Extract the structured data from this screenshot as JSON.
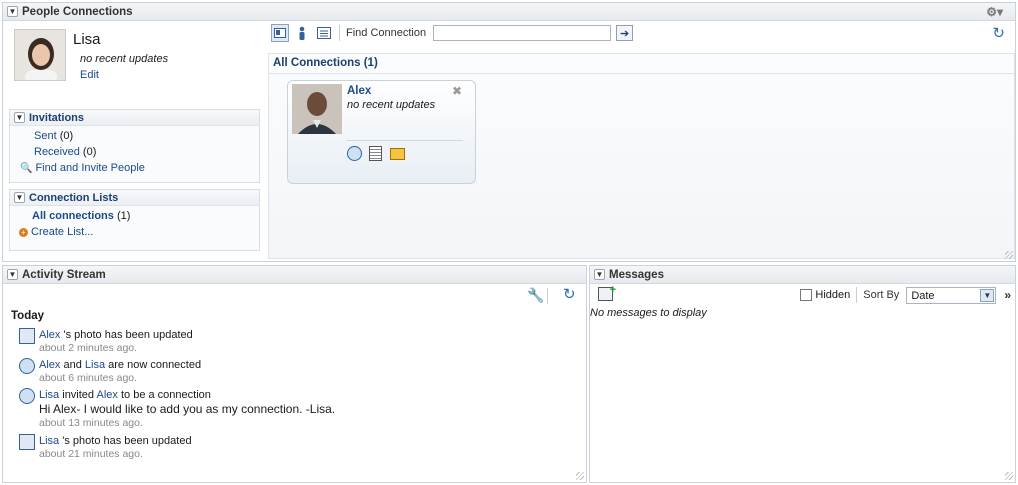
{
  "people_connections": {
    "title": "People Connections",
    "profile": {
      "name": "Lisa",
      "status": "no recent updates",
      "edit": "Edit"
    },
    "invitations": {
      "title": "Invitations",
      "sent_label": "Sent",
      "sent_count": "(0)",
      "received_label": "Received",
      "received_count": "(0)",
      "find_invite": "Find and Invite People"
    },
    "connection_lists": {
      "title": "Connection Lists",
      "all_label": "All connections",
      "all_count": "(1)",
      "create": "Create List..."
    },
    "toolbar": {
      "find_label": "Find Connection",
      "find_value": ""
    },
    "all_connections_title": "All Connections (1)",
    "card": {
      "name": "Alex",
      "status": "no recent updates"
    }
  },
  "activity_stream": {
    "title": "Activity Stream",
    "section": "Today",
    "items": [
      {
        "a": "Alex",
        "text": "'s photo has been updated",
        "time": "about 2 minutes ago."
      },
      {
        "a": "Alex",
        "mid": "and",
        "b": "Lisa",
        "text": "are now connected",
        "time": "about 6 minutes ago."
      },
      {
        "a": "Lisa",
        "mid": "invited",
        "b": "Alex",
        "text": "to be a connection",
        "message": "Hi Alex- I would like to add you as my connection. -Lisa.",
        "time": "about 13 minutes ago."
      },
      {
        "a": "Lisa",
        "text": "'s photo has been updated",
        "time": "about 21 minutes ago."
      }
    ]
  },
  "messages": {
    "title": "Messages",
    "hidden_label": "Hidden",
    "sort_label": "Sort By",
    "sort_value": "Date",
    "empty": "No messages to display"
  },
  "colors": {
    "link": "#1b4a8a",
    "header_bg": "#e6eaee",
    "panel_border": "#c9d2dc"
  }
}
